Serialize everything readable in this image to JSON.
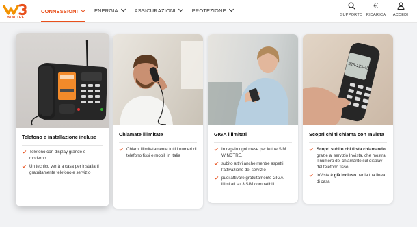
{
  "header": {
    "logo_text": "WINDTRE",
    "nav": [
      {
        "label": "CONNESSIONI",
        "active": true
      },
      {
        "label": "ENERGIA",
        "active": false
      },
      {
        "label": "ASSICURAZIONI",
        "active": false
      },
      {
        "label": "PROTEZIONE",
        "active": false
      }
    ],
    "tools": [
      {
        "label": "SUPPORTO",
        "icon": "search-icon"
      },
      {
        "label": "RICARICA",
        "icon": "euro-icon"
      },
      {
        "label": "ACCEDI",
        "icon": "user-icon"
      }
    ]
  },
  "colors": {
    "accent": "#e8501c",
    "background": "#f1f2f4"
  },
  "cards": [
    {
      "title": "Telefono e installazione incluse",
      "image": "desk-phone-image",
      "bullets": [
        "Telefono con display grande e moderno.",
        "Un tecnico verrà a casa per installarti gratuitamente telefono e servizio"
      ]
    },
    {
      "title": "Chiamate illimitate",
      "image": "man-on-phone-image",
      "bullets": [
        "Chiami illimitatamente tutti i numeri di telefono fissi e mobili in Italia"
      ]
    },
    {
      "title": "GIGA illimitati",
      "image": "woman-with-smartphone-image",
      "bullets": [
        "In regalo ogni mese per le tue SIM WINDTRE.",
        "subito attivi anche mentre aspetti l'attivazione del servizio",
        "puoi attivare gratuitamente GIGA illimitati su 3 SIM compatibili"
      ]
    },
    {
      "title": "Scopri chi ti chiama con InVista",
      "image": "cordless-phone-image",
      "bullets_rich": [
        {
          "bold": "Scopri subito chi ti sta chiamando",
          "rest": " grazie al servizio InVista, che mostra il numero del chiamante sul display del telefono fisso"
        },
        {
          "pre": "InVista è ",
          "bold": "già incluso",
          "rest": " per la tua linea di casa"
        }
      ]
    }
  ],
  "phone_display_text": "325-123-456"
}
